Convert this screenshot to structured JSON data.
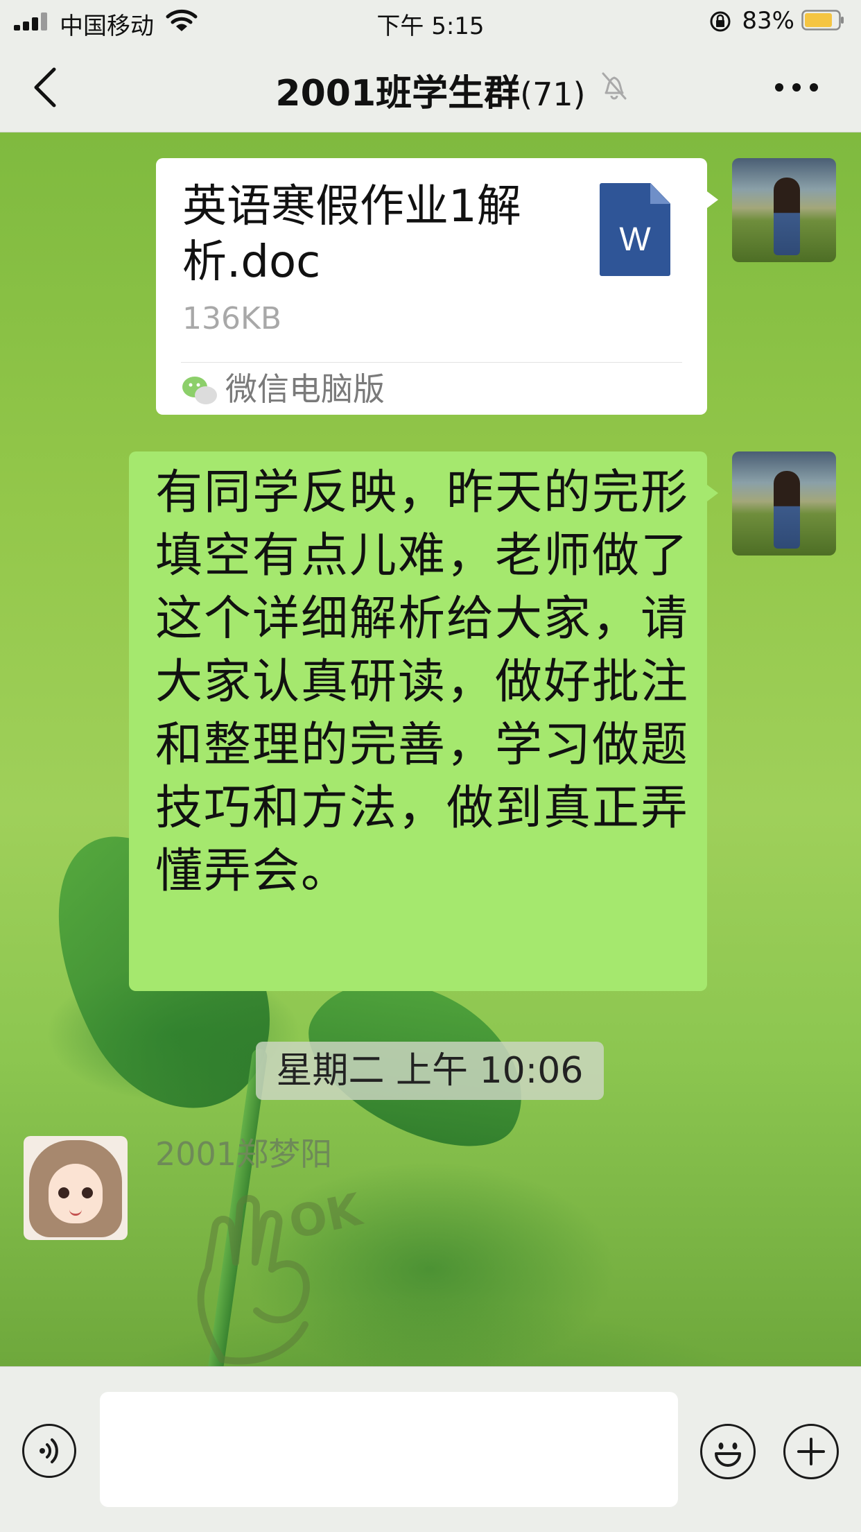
{
  "status_bar": {
    "carrier": "中国移动",
    "time": "下午 5:15",
    "battery_percent": "83%",
    "battery_level": 0.83,
    "battery_color": "#f5c542",
    "icons": [
      "signal-icon",
      "wifi-icon",
      "orientation-lock-icon",
      "battery-icon"
    ]
  },
  "nav": {
    "title": "2001班学生群",
    "member_count": "(71)",
    "icons": [
      "back-icon",
      "mute-icon",
      "more-icon"
    ]
  },
  "messages": [
    {
      "type": "file",
      "file_name": "英语寒假作业1解析.doc",
      "file_size": "136KB",
      "source": "微信电脑版",
      "file_icon": "word-doc-icon",
      "file_icon_letter": "W"
    },
    {
      "type": "text",
      "text": "有同学反映，昨天的完形填空有点儿难，老师做了这个详细解析给大家，请大家认真研读，做好批注和整理的完善，学习做题技巧和方法，做到真正弄懂弄会。"
    }
  ],
  "timestamp": "星期二 上午 10:06",
  "incoming": {
    "sender_name": "2001郑梦阳",
    "sticker": "ok-hand-sticker",
    "sticker_text": "OK"
  },
  "input_bar": {
    "placeholder": "",
    "icons": [
      "voice-icon",
      "emoji-icon",
      "plus-icon"
    ]
  },
  "colors": {
    "bubble_sent": "#a5e86e",
    "bubble_file": "#ffffff",
    "bar_background": "#eceeea",
    "word_blue": "#2f5597"
  }
}
